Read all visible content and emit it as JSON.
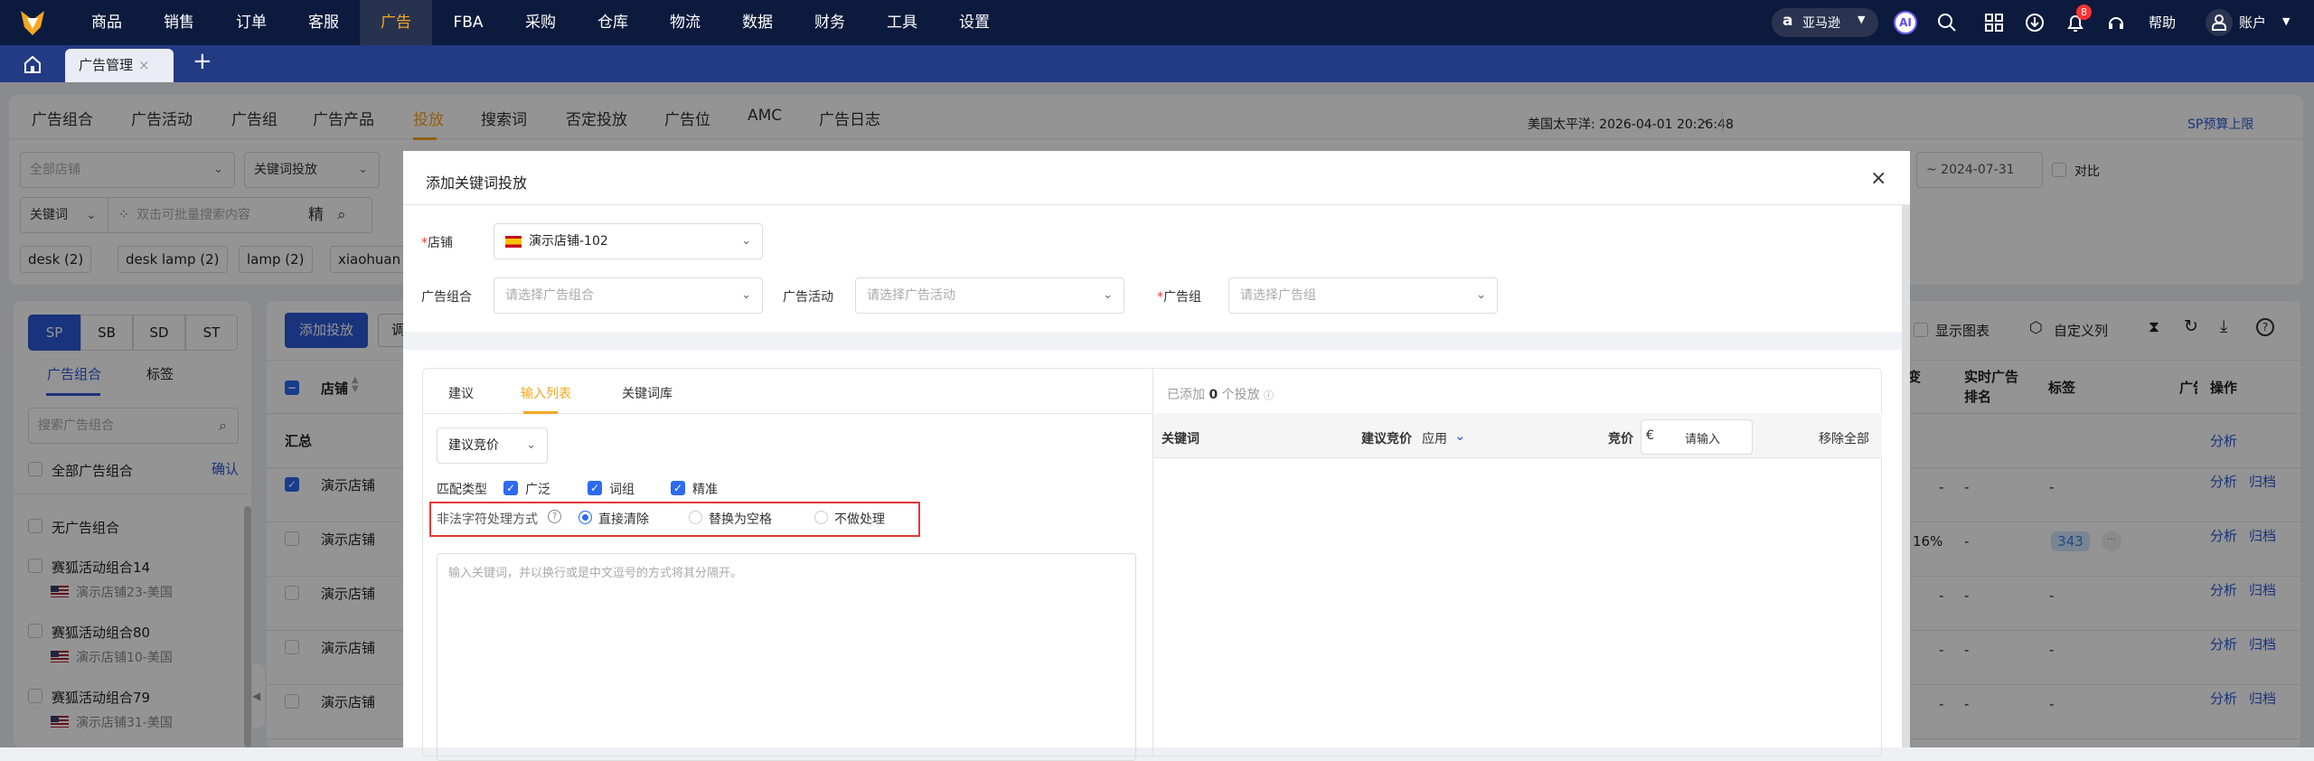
{
  "topnav": {
    "menu": [
      "商品",
      "销售",
      "订单",
      "客服",
      "广告",
      "FBA",
      "采购",
      "仓库",
      "物流",
      "数据",
      "财务",
      "工具",
      "设置"
    ],
    "active": "广告",
    "platform": "亚马逊",
    "ai": "AI",
    "notification_count": "8",
    "help": "帮助",
    "account": "账户"
  },
  "tabbar": {
    "tab": "广告管理",
    "close": "×",
    "add": "+"
  },
  "subnav": {
    "tabs": [
      "广告组合",
      "广告活动",
      "广告组",
      "广告产品",
      "投放",
      "搜索词",
      "否定投放",
      "广告位",
      "AMC",
      "广告日志"
    ],
    "timezone": "美国太平洋: 2026-04-01 20:26:48",
    "budget_link": "SP预算上限"
  },
  "filters": {
    "store_placeholder": "全部店铺",
    "type": "关键词投放",
    "search_field": "关键词",
    "search_placeholder": "双击可批量搜索内容",
    "exact": "精",
    "date_end": "~  2024-07-31",
    "compare": "对比",
    "chips": [
      "desk (2)",
      "desk lamp (2)",
      "lamp (2)",
      "xiaohuan"
    ]
  },
  "sidebar": {
    "ad_types": [
      "SP",
      "SB",
      "SD",
      "ST"
    ],
    "tabs": [
      "广告组合",
      "标签"
    ],
    "search_placeholder": "搜索广告组合",
    "all": "全部广告组合",
    "confirm": "确认",
    "items": [
      {
        "name": "无广告组合",
        "store": ""
      },
      {
        "name": "赛狐活动组合14",
        "store": "演示店铺23-美国"
      },
      {
        "name": "赛狐活动组合80",
        "store": "演示店铺10-美国"
      },
      {
        "name": "赛狐活动组合79",
        "store": "演示店铺31-美国"
      }
    ]
  },
  "table": {
    "add_button": "添加投放",
    "adjust_button": "调",
    "show_chart": "显示图表",
    "custom_columns": "自定义列",
    "headers": {
      "store": "店铺",
      "change": "变",
      "rank_1": "实时广告",
      "rank_2": "排名",
      "tags": "标签",
      "ad": "广告",
      "ops": "操作"
    },
    "summary": "汇总",
    "summary_op": "分析",
    "rows": [
      {
        "store": "演示店铺",
        "change": "-",
        "rank": "-",
        "tag": "-",
        "op1": "分析",
        "op2": "归档"
      },
      {
        "store": "演示店铺",
        "change": "16%",
        "rank": "-",
        "tag": "343",
        "op1": "分析",
        "op2": "归档"
      },
      {
        "store": "演示店铺",
        "change": "-",
        "rank": "-",
        "tag": "-",
        "op1": "分析",
        "op2": "归档"
      },
      {
        "store": "演示店铺",
        "change": "-",
        "rank": "-",
        "tag": "-",
        "op1": "分析",
        "op2": "归档"
      },
      {
        "store": "演示店铺",
        "change": "-",
        "rank": "-",
        "tag": "-",
        "op1": "分析",
        "op2": "归档"
      }
    ]
  },
  "modal": {
    "title": "添加关键词投放",
    "store_label": "店铺",
    "store_value": "演示店铺-102",
    "portfolio_label": "广告组合",
    "portfolio_placeholder": "请选择广告组合",
    "campaign_label": "广告活动",
    "campaign_placeholder": "请选择广告活动",
    "adgroup_label": "广告组",
    "adgroup_placeholder": "请选择广告组",
    "tabs": [
      "建议",
      "输入列表",
      "关键词库"
    ],
    "active_tab": "输入列表",
    "bid_select": "建议竞价",
    "match_label": "匹配类型",
    "match_types": [
      "广泛",
      "词组",
      "精准"
    ],
    "illegal_label": "非法字符处理方式",
    "illegal_options": [
      "直接清除",
      "替换为空格",
      "不做处理"
    ],
    "illegal_selected": "直接清除",
    "textarea_placeholder": "输入关键词，并以换行或是中文逗号的方式将其分隔开。",
    "added_prefix": "已添加",
    "added_count": "0",
    "added_suffix": "个投放",
    "col_keyword": "关键词",
    "col_suggested": "建议竞价",
    "apply": "应用",
    "col_bid": "竞价",
    "currency": "€",
    "bid_placeholder": "请输入",
    "remove_all": "移除全部"
  },
  "colors": {
    "nav": "#0c1a3d",
    "tabbar": "#233a85",
    "accent": "#f5a623",
    "primary": "#2c6af0",
    "highlight_box": "#e53935"
  }
}
